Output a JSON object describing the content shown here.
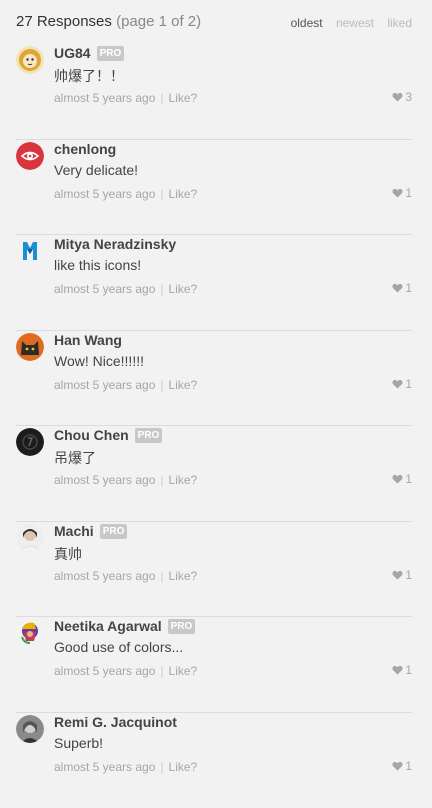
{
  "header": {
    "count_label": "27 Responses",
    "page_label": "(page 1 of 2)",
    "sort": {
      "oldest": "oldest",
      "newest": "newest",
      "liked": "liked"
    }
  },
  "like_label": "Like?",
  "separator": "|",
  "responses": [
    {
      "name": "UG84",
      "pro": "PRO",
      "comment": "帅爆了！！",
      "time": "almost 5 years ago",
      "likes": "3",
      "avatar": "lion-avatar",
      "color": "#e0a53a"
    },
    {
      "name": "chenlong",
      "pro": "",
      "comment": "Very delicate!",
      "time": "almost 5 years ago",
      "likes": "1",
      "avatar": "red-eye-avatar",
      "color": "#d8363c"
    },
    {
      "name": "Mitya Neradzinsky",
      "pro": "",
      "comment": "like this icons!",
      "time": "almost 5 years ago",
      "likes": "1",
      "avatar": "m-logo-avatar",
      "color": "#1a8fd6"
    },
    {
      "name": "Han Wang",
      "pro": "",
      "comment": "Wow! Nice!!!!!!",
      "time": "almost 5 years ago",
      "likes": "1",
      "avatar": "cat-avatar",
      "color": "#2b2b2b"
    },
    {
      "name": "Chou Chen",
      "pro": "PRO",
      "comment": "吊爆了",
      "time": "almost 5 years ago",
      "likes": "1",
      "avatar": "dark-logo-avatar",
      "color": "#1c1c1c"
    },
    {
      "name": "Machi",
      "pro": "PRO",
      "comment": "真帅",
      "time": "almost 5 years ago",
      "likes": "1",
      "avatar": "photo-avatar",
      "color": "#d9c6b6"
    },
    {
      "name": "Neetika Agarwal",
      "pro": "PRO",
      "comment": "Good use of colors...",
      "time": "almost 5 years ago",
      "likes": "1",
      "avatar": "colorful-avatar",
      "color": "#6a3d9a"
    },
    {
      "name": "Remi G. Jacquinot",
      "pro": "",
      "comment": "Superb!",
      "time": "almost 5 years ago",
      "likes": "1",
      "avatar": "bw-photo-avatar",
      "color": "#555555"
    }
  ]
}
